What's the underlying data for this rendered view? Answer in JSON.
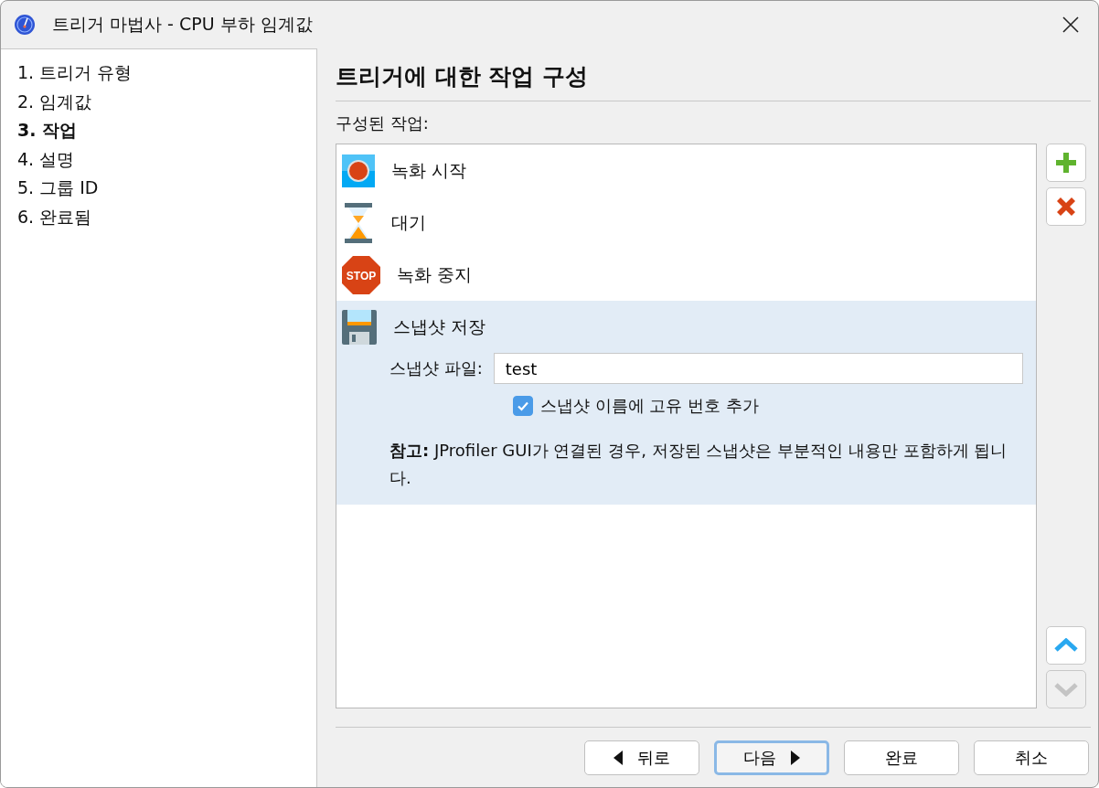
{
  "window": {
    "title": "트리거 마법사 - CPU 부하 임계값"
  },
  "steps": [
    {
      "label": "1. 트리거 유형",
      "selected": false
    },
    {
      "label": "2. 임계값",
      "selected": false
    },
    {
      "label": "3. 작업",
      "selected": true
    },
    {
      "label": "4. 설명",
      "selected": false
    },
    {
      "label": "5. 그룹 ID",
      "selected": false
    },
    {
      "label": "6. 완료됨",
      "selected": false
    }
  ],
  "heading": "트리거에 대한 작업 구성",
  "actions_label": "구성된 작업:",
  "actions": [
    {
      "label": "녹화 시작",
      "kind": "record",
      "selected": false
    },
    {
      "label": "대기",
      "kind": "wait",
      "selected": false
    },
    {
      "label": "녹화 중지",
      "kind": "stop",
      "icon_text": "STOP",
      "selected": false
    },
    {
      "label": "스냅샷 저장",
      "kind": "save",
      "selected": true,
      "details": {
        "file_label": "스냅샷 파일:",
        "file_value": "test",
        "checkbox": {
          "label": "스냅샷 이름에 고유 번호 추가",
          "checked": true
        },
        "note": "**참고:** JProfiler GUI가 연결된 경우, 저장된 스냅샷은 부분적인 내용만 포함하게 됩니다."
      }
    }
  ],
  "side_buttons": [
    {
      "kind": "add",
      "disabled": false
    },
    {
      "kind": "remove",
      "disabled": false
    },
    {
      "kind": "move_up",
      "disabled": false
    },
    {
      "kind": "move_down",
      "disabled": true
    }
  ],
  "buttons": [
    {
      "label": "뒤로",
      "kind": "back",
      "focused": false
    },
    {
      "label": "다음",
      "kind": "next",
      "focused": true
    },
    {
      "label": "완료",
      "kind": "plain",
      "focused": false
    },
    {
      "label": "취소",
      "kind": "plain",
      "focused": false
    }
  ]
}
